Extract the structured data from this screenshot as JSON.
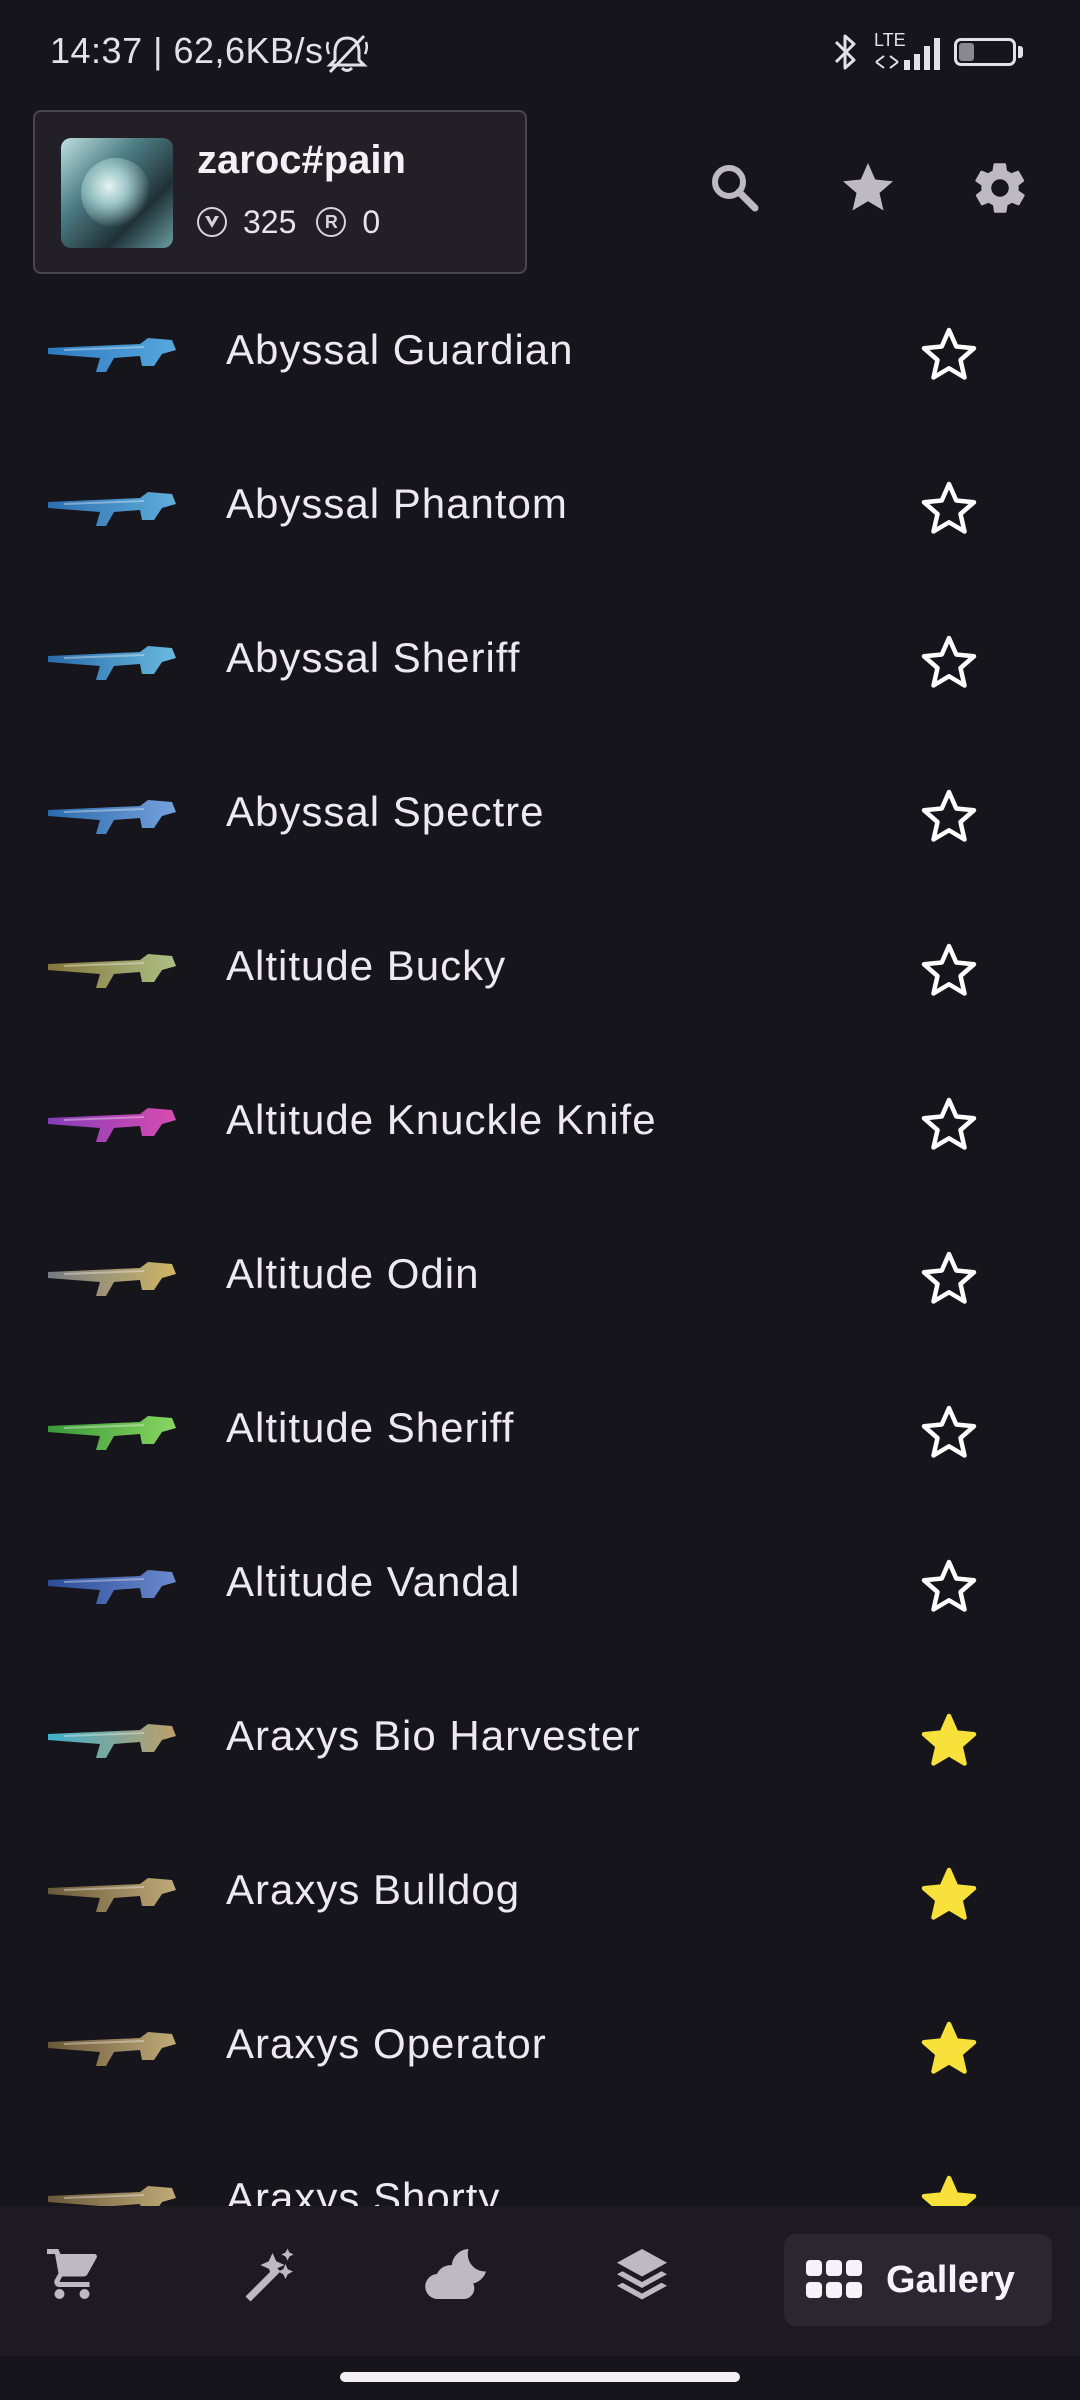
{
  "status_bar": {
    "time_speed": "14:37 | 62,6KB/s",
    "network": "LTE",
    "battery_level": "29",
    "battery_fraction": 0.29,
    "icons": [
      "mute-bell-icon",
      "bluetooth-icon",
      "signal-icon",
      "battery-icon"
    ]
  },
  "header": {
    "username": "zaroc#pain",
    "valorant_points": "325",
    "radianite_points": "0",
    "radianite_symbol": "R",
    "icons": [
      "search-icon",
      "star-icon",
      "gear-icon"
    ]
  },
  "skins": [
    {
      "name": "Abyssal Guardian",
      "favorite": false,
      "thumb_colors": [
        "#2f7fc7",
        "#5ab0e8"
      ]
    },
    {
      "name": "Abyssal Phantom",
      "favorite": false,
      "thumb_colors": [
        "#2d73b8",
        "#63b6e5"
      ]
    },
    {
      "name": "Abyssal Sheriff",
      "favorite": false,
      "thumb_colors": [
        "#2a6fb0",
        "#6ec3ea"
      ]
    },
    {
      "name": "Abyssal Spectre",
      "favorite": false,
      "thumb_colors": [
        "#2b6fb4",
        "#7aa8e6"
      ]
    },
    {
      "name": "Altitude Bucky",
      "favorite": false,
      "thumb_colors": [
        "#8a7a3e",
        "#b6c98a"
      ]
    },
    {
      "name": "Altitude Knuckle Knife",
      "favorite": false,
      "thumb_colors": [
        "#8a3fc0",
        "#e24fb8"
      ]
    },
    {
      "name": "Altitude Odin",
      "favorite": false,
      "thumb_colors": [
        "#7b7f88",
        "#d9c06a"
      ]
    },
    {
      "name": "Altitude Sheriff",
      "favorite": false,
      "thumb_colors": [
        "#3b9f3a",
        "#8fe065"
      ]
    },
    {
      "name": "Altitude Vandal",
      "favorite": false,
      "thumb_colors": [
        "#2d4f9e",
        "#6f8fd6"
      ]
    },
    {
      "name": "Araxys Bio Harvester",
      "favorite": true,
      "thumb_colors": [
        "#3fb8d8",
        "#c9a66b"
      ]
    },
    {
      "name": "Araxys Bulldog",
      "favorite": true,
      "thumb_colors": [
        "#6d5c3c",
        "#c9b27d"
      ]
    },
    {
      "name": "Araxys Operator",
      "favorite": true,
      "thumb_colors": [
        "#6d5c3c",
        "#c9b27d"
      ]
    },
    {
      "name": "Araxys Shorty",
      "favorite": true,
      "thumb_colors": [
        "#6d5c3c",
        "#c9b27d"
      ]
    }
  ],
  "colors": {
    "background": "#17151c",
    "favorite_star": "#f7e13a",
    "empty_star": "#ffffff",
    "icon_gray": "#bdbac4"
  },
  "bottom_nav": {
    "items": [
      "cart-icon",
      "magic-wand-icon",
      "night-market-icon",
      "layers-icon"
    ],
    "active_label": "Gallery",
    "active_icon": "grid-icon"
  }
}
